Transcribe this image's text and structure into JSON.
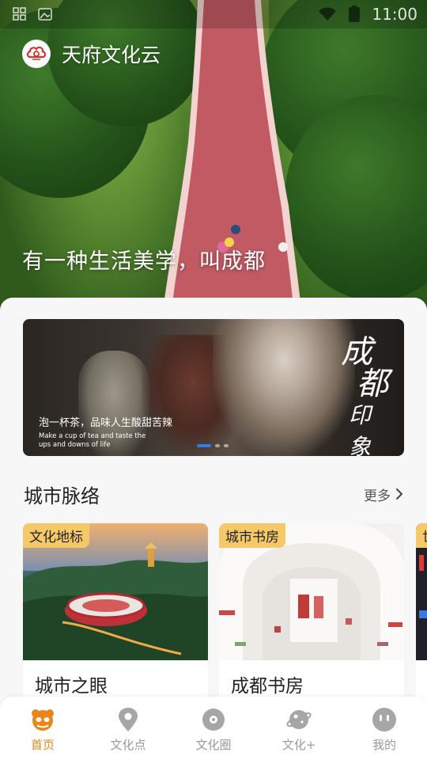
{
  "status_bar": {
    "time": "11:00"
  },
  "header": {
    "app_name": "天府文化云",
    "slogan": "有一种生活美学，叫成都"
  },
  "banner": {
    "title_chars": [
      "成",
      "都",
      "印",
      "象"
    ],
    "tagline_cn": "泡一杯茶，品味人生酸甜苦辣",
    "tagline_en": "Make a cup of tea and taste the ups and downs of life",
    "active_index": 0,
    "count": 3
  },
  "city_section": {
    "title": "城市脉络",
    "more_label": "更多",
    "cards": [
      {
        "badge": "文化地标",
        "title": "城市之眼"
      },
      {
        "badge": "城市书房",
        "title": "成都书房"
      },
      {
        "badge": "世"
      }
    ]
  },
  "tabbar": {
    "items": [
      {
        "label": "首页",
        "icon": "panda-home-icon",
        "active": true
      },
      {
        "label": "文化点",
        "icon": "location-pin-icon",
        "active": false
      },
      {
        "label": "文化圈",
        "icon": "circle-disc-icon",
        "active": false
      },
      {
        "label": "文化+",
        "icon": "planet-icon",
        "active": false
      },
      {
        "label": "我的",
        "icon": "profile-face-icon",
        "active": false
      }
    ]
  },
  "colors": {
    "accent": "#e8861a",
    "badge": "#f5c968",
    "indicator": "#2f7ce8",
    "tab_inactive": "#9a9a9a"
  }
}
